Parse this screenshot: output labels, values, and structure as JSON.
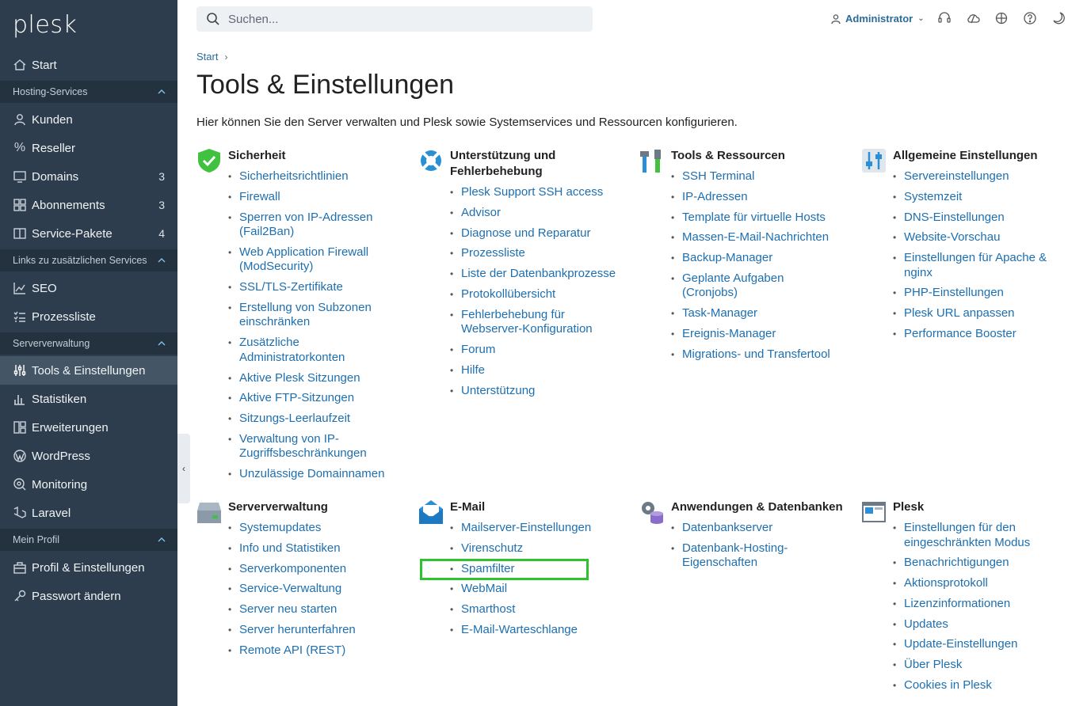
{
  "app": {
    "logo": "plesk"
  },
  "sidebar": {
    "start": "Start",
    "sections": [
      {
        "label": "Hosting-Services",
        "items": [
          {
            "label": "Kunden",
            "count": ""
          },
          {
            "label": "Reseller",
            "count": ""
          },
          {
            "label": "Domains",
            "count": "3"
          },
          {
            "label": "Abonnements",
            "count": "3"
          },
          {
            "label": "Service-Pakete",
            "count": "4"
          }
        ]
      },
      {
        "label": "Links zu zusätzlichen Services",
        "items": [
          {
            "label": "SEO"
          },
          {
            "label": "Prozessliste"
          }
        ]
      },
      {
        "label": "Serververwaltung",
        "items": [
          {
            "label": "Tools & Einstellungen"
          },
          {
            "label": "Statistiken"
          },
          {
            "label": "Erweiterungen"
          },
          {
            "label": "WordPress"
          },
          {
            "label": "Monitoring"
          },
          {
            "label": "Laravel"
          }
        ]
      },
      {
        "label": "Mein Profil",
        "items": [
          {
            "label": "Profil & Einstellungen"
          },
          {
            "label": "Passwort ändern"
          }
        ]
      }
    ]
  },
  "header": {
    "search_placeholder": "Suchen...",
    "user": "Administrator"
  },
  "breadcrumb": "Start",
  "page": {
    "title": "Tools & Einstellungen",
    "description": "Hier können Sie den Server verwalten und Plesk sowie Systemservices und Ressourcen konfigurieren."
  },
  "groups": [
    {
      "title": "Sicherheit",
      "icon": "shield-icon",
      "links": [
        "Sicherheitsrichtlinien",
        "Firewall",
        "Sperren von IP-Adressen (Fail2Ban)",
        "Web Application Firewall (ModSecurity)",
        "SSL/TLS-Zertifikate",
        "Erstellung von Subzonen einschränken",
        "Zusätzliche Administratorkonten",
        "Aktive Plesk Sitzungen",
        "Aktive FTP-Sitzungen",
        "Sitzungs-Leerlaufzeit",
        "Verwaltung von IP-Zugriffsbeschränkungen",
        "Unzulässige Domainnamen"
      ]
    },
    {
      "title": "Unterstützung und Fehlerbehebung",
      "icon": "lifebuoy-icon",
      "links": [
        "Plesk Support SSH access",
        "Advisor",
        "Diagnose und Reparatur",
        "Prozessliste",
        "Liste der Datenbankprozesse",
        "Protokollübersicht",
        "Fehlerbehebung für Webserver-Konfiguration",
        "Forum",
        "Hilfe",
        "Unterstützung"
      ]
    },
    {
      "title": "Tools & Ressourcen",
      "icon": "tools-icon",
      "links": [
        "SSH Terminal",
        "IP-Adressen",
        "Template für virtuelle Hosts",
        "Massen-E-Mail-Nachrichten",
        "Backup-Manager",
        "Geplante Aufgaben (Cronjobs)",
        "Task-Manager",
        "Ereignis-Manager",
        "Migrations- und Transfertool"
      ]
    },
    {
      "title": "Allgemeine Einstellungen",
      "icon": "sliders-icon",
      "links": [
        "Servereinstellungen",
        "Systemzeit",
        "DNS-Einstellungen",
        "Website-Vorschau",
        "Einstellungen für Apache & nginx",
        "PHP-Einstellungen",
        "Plesk URL anpassen",
        "Performance Booster"
      ]
    },
    {
      "title": "Serververwaltung",
      "icon": "server-icon",
      "links": [
        "Systemupdates",
        "Info und Statistiken",
        "Serverkomponenten",
        "Service-Verwaltung",
        "Server neu starten",
        "Server herunterfahren",
        "Remote API (REST)"
      ]
    },
    {
      "title": "E-Mail",
      "icon": "mail-icon",
      "links": [
        "Mailserver-Einstellungen",
        "Virenschutz",
        "Spamfilter",
        "WebMail",
        "Smarthost",
        "E-Mail-Warteschlange"
      ]
    },
    {
      "title": "Anwendungen & Datenbanken",
      "icon": "database-gear-icon",
      "links": [
        "Datenbankserver",
        "Datenbank-Hosting-Eigenschaften"
      ]
    },
    {
      "title": "Plesk",
      "icon": "plesk-window-icon",
      "links": [
        "Einstellungen für den eingeschränkten Modus",
        "Benachrichtigungen",
        "Aktionsprotokoll",
        "Lizenzinformationen",
        "Updates",
        "Update-Einstellungen",
        "Über Plesk",
        "Cookies in Plesk"
      ]
    }
  ],
  "colors": {
    "sidebar_bg": "#2e3d4d",
    "link": "#1d6fb0",
    "highlight": "#2ec22e"
  }
}
